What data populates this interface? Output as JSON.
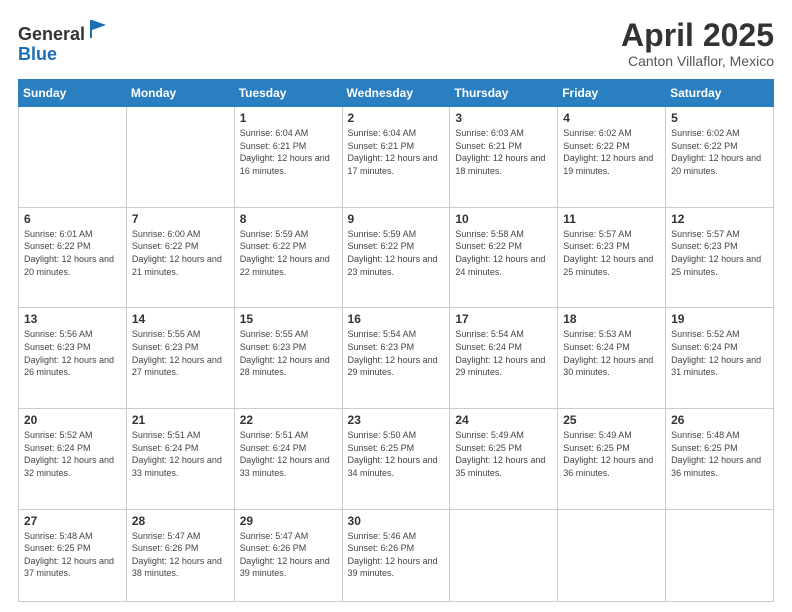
{
  "header": {
    "logo_general": "General",
    "logo_blue": "Blue",
    "title": "April 2025",
    "subtitle": "Canton Villaflor, Mexico"
  },
  "weekdays": [
    "Sunday",
    "Monday",
    "Tuesday",
    "Wednesday",
    "Thursday",
    "Friday",
    "Saturday"
  ],
  "weeks": [
    [
      {
        "day": "",
        "info": ""
      },
      {
        "day": "",
        "info": ""
      },
      {
        "day": "1",
        "info": "Sunrise: 6:04 AM\nSunset: 6:21 PM\nDaylight: 12 hours and 16 minutes."
      },
      {
        "day": "2",
        "info": "Sunrise: 6:04 AM\nSunset: 6:21 PM\nDaylight: 12 hours and 17 minutes."
      },
      {
        "day": "3",
        "info": "Sunrise: 6:03 AM\nSunset: 6:21 PM\nDaylight: 12 hours and 18 minutes."
      },
      {
        "day": "4",
        "info": "Sunrise: 6:02 AM\nSunset: 6:22 PM\nDaylight: 12 hours and 19 minutes."
      },
      {
        "day": "5",
        "info": "Sunrise: 6:02 AM\nSunset: 6:22 PM\nDaylight: 12 hours and 20 minutes."
      }
    ],
    [
      {
        "day": "6",
        "info": "Sunrise: 6:01 AM\nSunset: 6:22 PM\nDaylight: 12 hours and 20 minutes."
      },
      {
        "day": "7",
        "info": "Sunrise: 6:00 AM\nSunset: 6:22 PM\nDaylight: 12 hours and 21 minutes."
      },
      {
        "day": "8",
        "info": "Sunrise: 5:59 AM\nSunset: 6:22 PM\nDaylight: 12 hours and 22 minutes."
      },
      {
        "day": "9",
        "info": "Sunrise: 5:59 AM\nSunset: 6:22 PM\nDaylight: 12 hours and 23 minutes."
      },
      {
        "day": "10",
        "info": "Sunrise: 5:58 AM\nSunset: 6:22 PM\nDaylight: 12 hours and 24 minutes."
      },
      {
        "day": "11",
        "info": "Sunrise: 5:57 AM\nSunset: 6:23 PM\nDaylight: 12 hours and 25 minutes."
      },
      {
        "day": "12",
        "info": "Sunrise: 5:57 AM\nSunset: 6:23 PM\nDaylight: 12 hours and 25 minutes."
      }
    ],
    [
      {
        "day": "13",
        "info": "Sunrise: 5:56 AM\nSunset: 6:23 PM\nDaylight: 12 hours and 26 minutes."
      },
      {
        "day": "14",
        "info": "Sunrise: 5:55 AM\nSunset: 6:23 PM\nDaylight: 12 hours and 27 minutes."
      },
      {
        "day": "15",
        "info": "Sunrise: 5:55 AM\nSunset: 6:23 PM\nDaylight: 12 hours and 28 minutes."
      },
      {
        "day": "16",
        "info": "Sunrise: 5:54 AM\nSunset: 6:23 PM\nDaylight: 12 hours and 29 minutes."
      },
      {
        "day": "17",
        "info": "Sunrise: 5:54 AM\nSunset: 6:24 PM\nDaylight: 12 hours and 29 minutes."
      },
      {
        "day": "18",
        "info": "Sunrise: 5:53 AM\nSunset: 6:24 PM\nDaylight: 12 hours and 30 minutes."
      },
      {
        "day": "19",
        "info": "Sunrise: 5:52 AM\nSunset: 6:24 PM\nDaylight: 12 hours and 31 minutes."
      }
    ],
    [
      {
        "day": "20",
        "info": "Sunrise: 5:52 AM\nSunset: 6:24 PM\nDaylight: 12 hours and 32 minutes."
      },
      {
        "day": "21",
        "info": "Sunrise: 5:51 AM\nSunset: 6:24 PM\nDaylight: 12 hours and 33 minutes."
      },
      {
        "day": "22",
        "info": "Sunrise: 5:51 AM\nSunset: 6:24 PM\nDaylight: 12 hours and 33 minutes."
      },
      {
        "day": "23",
        "info": "Sunrise: 5:50 AM\nSunset: 6:25 PM\nDaylight: 12 hours and 34 minutes."
      },
      {
        "day": "24",
        "info": "Sunrise: 5:49 AM\nSunset: 6:25 PM\nDaylight: 12 hours and 35 minutes."
      },
      {
        "day": "25",
        "info": "Sunrise: 5:49 AM\nSunset: 6:25 PM\nDaylight: 12 hours and 36 minutes."
      },
      {
        "day": "26",
        "info": "Sunrise: 5:48 AM\nSunset: 6:25 PM\nDaylight: 12 hours and 36 minutes."
      }
    ],
    [
      {
        "day": "27",
        "info": "Sunrise: 5:48 AM\nSunset: 6:25 PM\nDaylight: 12 hours and 37 minutes."
      },
      {
        "day": "28",
        "info": "Sunrise: 5:47 AM\nSunset: 6:26 PM\nDaylight: 12 hours and 38 minutes."
      },
      {
        "day": "29",
        "info": "Sunrise: 5:47 AM\nSunset: 6:26 PM\nDaylight: 12 hours and 39 minutes."
      },
      {
        "day": "30",
        "info": "Sunrise: 5:46 AM\nSunset: 6:26 PM\nDaylight: 12 hours and 39 minutes."
      },
      {
        "day": "",
        "info": ""
      },
      {
        "day": "",
        "info": ""
      },
      {
        "day": "",
        "info": ""
      }
    ]
  ],
  "colors": {
    "header_bg": "#2a7fc1",
    "header_text": "#ffffff",
    "border": "#cccccc"
  }
}
